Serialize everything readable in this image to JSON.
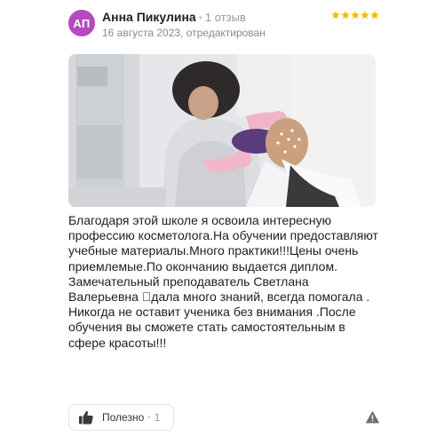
{
  "author": {
    "initials": "АП",
    "name": "Анна Пикулина",
    "review_count": "1 отзыв",
    "date": "16 августа 2023, отредактирован",
    "avatar_color": "#b44ac0"
  },
  "rating": {
    "stars": 5,
    "max": 5,
    "star_color": "#f5b800"
  },
  "photo": {
    "icon": "review-photo"
  },
  "review": {
    "text": "Благодаря этой школе я освоила интересную профессию косметолога.На обучении предоставляют учебные материалы.Много практики!!!Цены очень приемлемые.По окончанию выдается диплом.\nЗамечательный преподаватель Светлана Валерьевна 󽏠дала много знаний, всегда помогала .\nНикогда не оставит ученика без внимания .После обучения вы сможете стать самостоятельным в сфере красоты!!!"
  },
  "footer": {
    "like_label": "Полезно",
    "like_count": "1",
    "like_icon": "thumbs-up-icon",
    "report_icon": "warning-icon"
  }
}
